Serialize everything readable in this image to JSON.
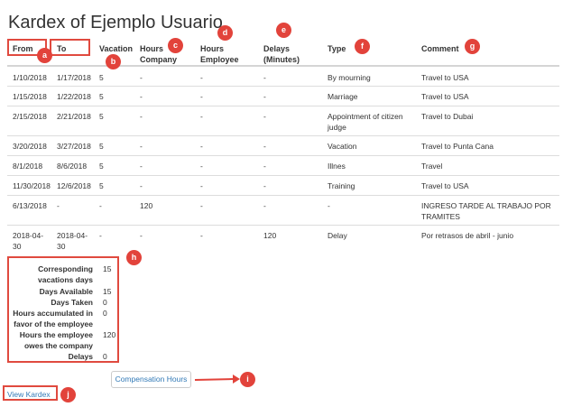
{
  "page": {
    "title": "Kardex of Ejemplo Usuario"
  },
  "table": {
    "headers": {
      "from": "From",
      "to": "To",
      "vacation": "Vacation",
      "hours_company": [
        "Hours",
        "Company"
      ],
      "hours_employee": [
        "Hours",
        "Employee"
      ],
      "delays": [
        "Delays",
        "(Minutes)"
      ],
      "type": "Type",
      "comment": "Comment"
    },
    "rows": [
      {
        "from": "1/10/2018",
        "to": "1/17/2018",
        "vacation": "5",
        "hours_company": "-",
        "hours_employee": "-",
        "delays": "-",
        "type": "By mourning",
        "comment": "Travel to USA"
      },
      {
        "from": "1/15/2018",
        "to": "1/22/2018",
        "vacation": "5",
        "hours_company": "-",
        "hours_employee": "-",
        "delays": "-",
        "type": "Marriage",
        "comment": "Travel to USA"
      },
      {
        "from": "2/15/2018",
        "to": "2/21/2018",
        "vacation": "5",
        "hours_company": "-",
        "hours_employee": "-",
        "delays": "-",
        "type": "Appointment of citizen judge",
        "comment": "Travel to Dubai"
      },
      {
        "from": "3/20/2018",
        "to": "3/27/2018",
        "vacation": "5",
        "hours_company": "-",
        "hours_employee": "-",
        "delays": "-",
        "type": "Vacation",
        "comment": "Travel to Punta Cana"
      },
      {
        "from": "8/1/2018",
        "to": "8/6/2018",
        "vacation": "5",
        "hours_company": "-",
        "hours_employee": "-",
        "delays": "-",
        "type": "Illnes",
        "comment": "Travel"
      },
      {
        "from": "11/30/2018",
        "to": "12/6/2018",
        "vacation": "5",
        "hours_company": "-",
        "hours_employee": "-",
        "delays": "-",
        "type": "Training",
        "comment": "Travel to USA"
      },
      {
        "from": "6/13/2018",
        "to": "-",
        "vacation": "-",
        "hours_company": "120",
        "hours_employee": "-",
        "delays": "-",
        "type": "-",
        "comment": "INGRESO TARDE AL TRABAJO POR TRAMITES"
      },
      {
        "from": "2018-04-30",
        "to": "2018-04-30",
        "vacation": "-",
        "hours_company": "-",
        "hours_employee": "-",
        "delays": "120",
        "type": "Delay",
        "comment": "Por retrasos de abril - junio"
      }
    ]
  },
  "summary": [
    {
      "label": "Corresponding vacations days",
      "value": "15"
    },
    {
      "label": "Days Available",
      "value": "15"
    },
    {
      "label": "Days Taken",
      "value": "0"
    },
    {
      "label": "Hours accumulated in favor of the employee",
      "value": "0"
    },
    {
      "label": "Hours the employee owes the company",
      "value": "120"
    },
    {
      "label": "Delays",
      "value": "0"
    }
  ],
  "buttons": {
    "compensation": "Compensation Hours"
  },
  "links": {
    "view_kardex": "View Kardex"
  },
  "annotations": [
    "a",
    "b",
    "c",
    "d",
    "e",
    "f",
    "g",
    "h",
    "i",
    "j"
  ],
  "colors": {
    "annotation": "#e2433b",
    "link": "#337ab7"
  }
}
